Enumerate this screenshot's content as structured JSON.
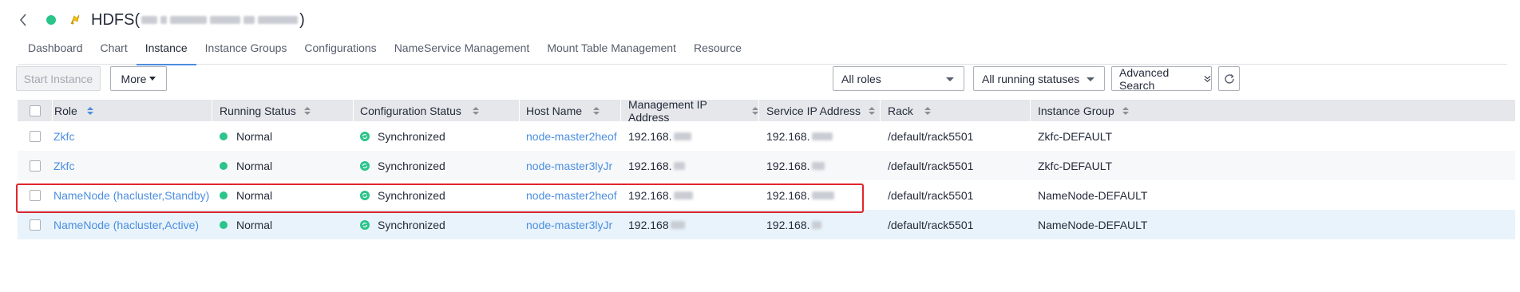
{
  "header": {
    "title": "HDFS",
    "title_open": "(",
    "title_close": ")",
    "status_color": "#2bc48a",
    "back_icon": "chevron-left-icon",
    "service_icon": "hdfs-icon"
  },
  "tabs": [
    {
      "label": "Dashboard",
      "active": false
    },
    {
      "label": "Chart",
      "active": false
    },
    {
      "label": "Instance",
      "active": true
    },
    {
      "label": "Instance Groups",
      "active": false
    },
    {
      "label": "Configurations",
      "active": false
    },
    {
      "label": "NameService Management",
      "active": false
    },
    {
      "label": "Mount Table Management",
      "active": false
    },
    {
      "label": "Resource",
      "active": false
    }
  ],
  "toolbar": {
    "start_instance_label": "Start Instance",
    "more_label": "More",
    "roles_select": "All roles",
    "status_select": "All running statuses",
    "advanced_search_label": "Advanced Search",
    "refresh_icon": "refresh-icon"
  },
  "table": {
    "columns": [
      "Role",
      "Running Status",
      "Configuration Status",
      "Host Name",
      "Management IP Address",
      "Service IP Address",
      "Rack",
      "Instance Group"
    ],
    "rows": [
      {
        "role": "Zkfc",
        "running_status": "Normal",
        "config_status": "Synchronized",
        "host": "node-master2heof",
        "mgmt_ip": "192.168.",
        "service_ip": "192.168.",
        "rack": "/default/rack5501",
        "group": "Zkfc-DEFAULT"
      },
      {
        "role": "Zkfc",
        "running_status": "Normal",
        "config_status": "Synchronized",
        "host": "node-master3lyJr",
        "mgmt_ip": "192.168.",
        "service_ip": "192.168.",
        "rack": "/default/rack5501",
        "group": "Zkfc-DEFAULT"
      },
      {
        "role": "NameNode (hacluster,Standby)",
        "running_status": "Normal",
        "config_status": "Synchronized",
        "host": "node-master2heof",
        "mgmt_ip": "192.168.",
        "service_ip": "192.168.",
        "rack": "/default/rack5501",
        "group": "NameNode-DEFAULT"
      },
      {
        "role": "NameNode (hacluster,Active)",
        "running_status": "Normal",
        "config_status": "Synchronized",
        "host": "node-master3lyJr",
        "mgmt_ip": "192.168",
        "service_ip": "192.168.",
        "rack": "/default/rack5501",
        "group": "NameNode-DEFAULT"
      }
    ]
  },
  "colors": {
    "accent": "#4b8ee0",
    "status_normal": "#2bc48a",
    "highlight_border": "#e0262d",
    "header_bg": "#e5e7eb"
  }
}
